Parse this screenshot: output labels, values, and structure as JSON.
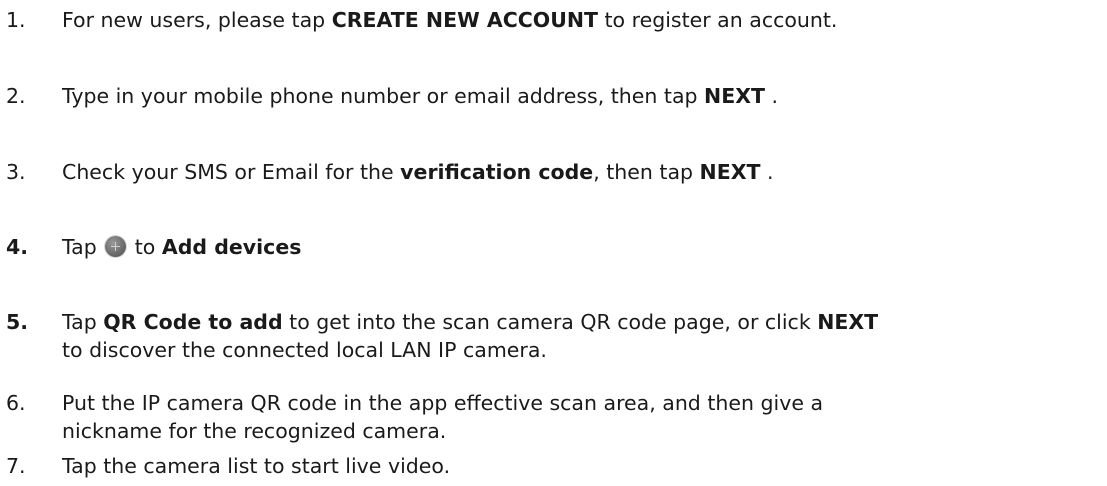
{
  "steps": [
    {
      "number": "1.",
      "t1": "For new users, please tap ",
      "b1": "CREATE NEW ACCOUNT",
      "t2": " to register an account."
    },
    {
      "number": "2.",
      "t1": "Type in your mobile phone number or email address, then tap ",
      "b1": "NEXT",
      "t2": " ."
    },
    {
      "number": "3.",
      "t1": "Check your SMS or Email for the ",
      "b1": "verification code",
      "t2": ", then tap ",
      "b2": "NEXT",
      "t3": " ."
    },
    {
      "number": "4.",
      "t1": "Tap ",
      "icon": "add-circle-icon",
      "t2": " to ",
      "b1": "Add devices"
    },
    {
      "number": "5.",
      "t1": "Tap ",
      "b1": "QR Code to add",
      "t2": " to get into the scan camera QR code page, or click ",
      "b2": "NEXT",
      "line2": "to discover the connected local LAN IP camera."
    },
    {
      "number": "6.",
      "line1": "Put the IP camera QR code in the app effective scan area, and then give a",
      "line2": "nickname for the recognized camera."
    },
    {
      "number": "7.",
      "t1": "Tap the camera list to start live video."
    }
  ]
}
